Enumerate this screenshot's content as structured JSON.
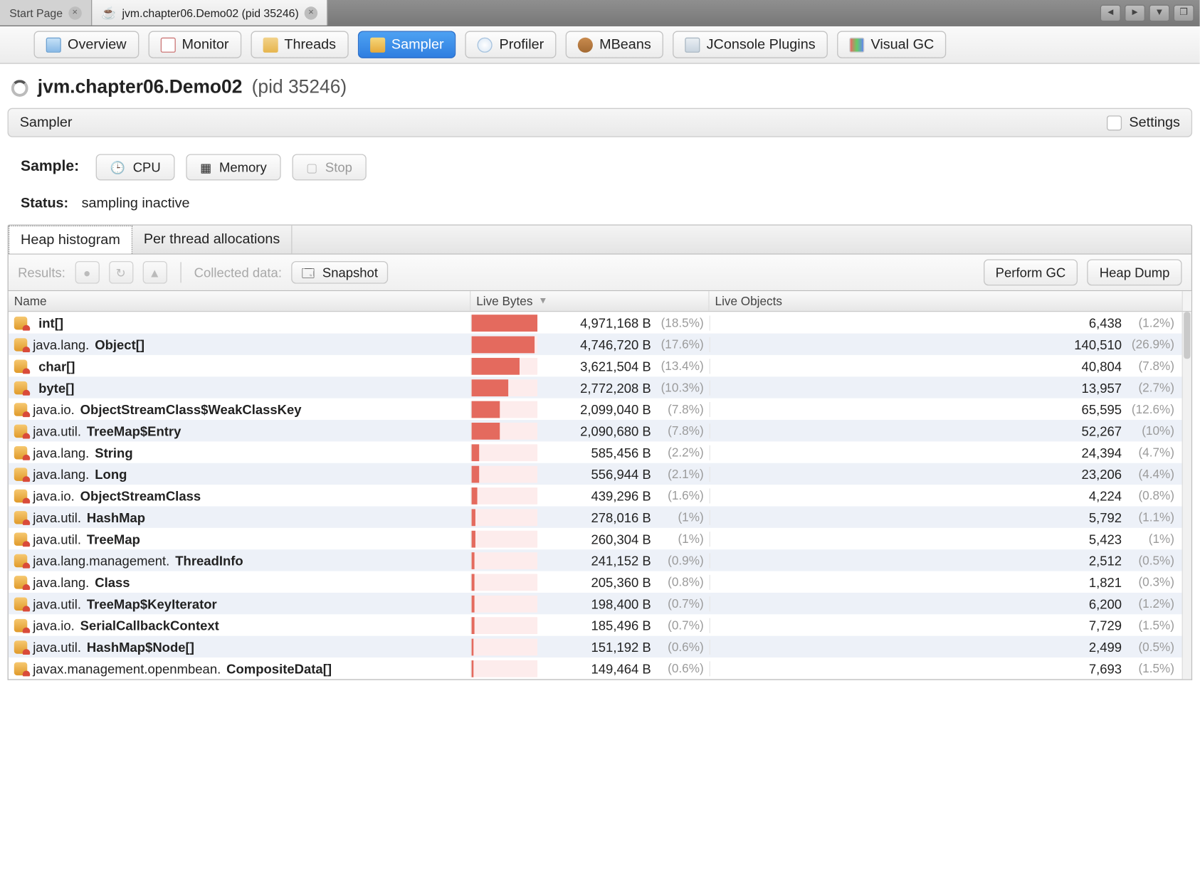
{
  "appTabs": {
    "startPage": "Start Page",
    "activeTab": "jvm.chapter06.Demo02 (pid 35246)"
  },
  "toolbar": {
    "overview": "Overview",
    "monitor": "Monitor",
    "threads": "Threads",
    "sampler": "Sampler",
    "profiler": "Profiler",
    "mbeans": "MBeans",
    "jconsole": "JConsole Plugins",
    "visualgc": "Visual GC"
  },
  "page": {
    "title_bold": "jvm.chapter06.Demo02",
    "title_pid": "(pid 35246)"
  },
  "section": {
    "name": "Sampler",
    "settings": "Settings"
  },
  "sample": {
    "label": "Sample:",
    "cpu": "CPU",
    "memory": "Memory",
    "stop": "Stop"
  },
  "status": {
    "label": "Status:",
    "value": "sampling inactive"
  },
  "subtabs": {
    "heap": "Heap histogram",
    "perthread": "Per thread allocations"
  },
  "resultsbar": {
    "results": "Results:",
    "collected": "Collected data:",
    "snapshot": "Snapshot",
    "performgc": "Perform GC",
    "heapdump": "Heap Dump"
  },
  "columns": {
    "name": "Name",
    "bytes": "Live Bytes",
    "objects": "Live Objects"
  },
  "rows": [
    {
      "prefix": "",
      "bold": "int[]",
      "bytes": "4,971,168 B",
      "bpct": "(18.5%)",
      "bar": 18.5,
      "objs": "6,438",
      "opct": "(1.2%)"
    },
    {
      "prefix": "java.lang.",
      "bold": "Object[]",
      "bytes": "4,746,720 B",
      "bpct": "(17.6%)",
      "bar": 17.6,
      "objs": "140,510",
      "opct": "(26.9%)"
    },
    {
      "prefix": "",
      "bold": "char[]",
      "bytes": "3,621,504 B",
      "bpct": "(13.4%)",
      "bar": 13.4,
      "objs": "40,804",
      "opct": "(7.8%)"
    },
    {
      "prefix": "",
      "bold": "byte[]",
      "bytes": "2,772,208 B",
      "bpct": "(10.3%)",
      "bar": 10.3,
      "objs": "13,957",
      "opct": "(2.7%)"
    },
    {
      "prefix": "java.io.",
      "bold": "ObjectStreamClass$WeakClassKey",
      "bytes": "2,099,040 B",
      "bpct": "(7.8%)",
      "bar": 7.8,
      "objs": "65,595",
      "opct": "(12.6%)"
    },
    {
      "prefix": "java.util.",
      "bold": "TreeMap$Entry",
      "bytes": "2,090,680 B",
      "bpct": "(7.8%)",
      "bar": 7.8,
      "objs": "52,267",
      "opct": "(10%)"
    },
    {
      "prefix": "java.lang.",
      "bold": "String",
      "bytes": "585,456 B",
      "bpct": "(2.2%)",
      "bar": 2.2,
      "objs": "24,394",
      "opct": "(4.7%)"
    },
    {
      "prefix": "java.lang.",
      "bold": "Long",
      "bytes": "556,944 B",
      "bpct": "(2.1%)",
      "bar": 2.1,
      "objs": "23,206",
      "opct": "(4.4%)"
    },
    {
      "prefix": "java.io.",
      "bold": "ObjectStreamClass",
      "bytes": "439,296 B",
      "bpct": "(1.6%)",
      "bar": 1.6,
      "objs": "4,224",
      "opct": "(0.8%)"
    },
    {
      "prefix": "java.util.",
      "bold": "HashMap",
      "bytes": "278,016 B",
      "bpct": "(1%)",
      "bar": 1.0,
      "objs": "5,792",
      "opct": "(1.1%)"
    },
    {
      "prefix": "java.util.",
      "bold": "TreeMap",
      "bytes": "260,304 B",
      "bpct": "(1%)",
      "bar": 1.0,
      "objs": "5,423",
      "opct": "(1%)"
    },
    {
      "prefix": "java.lang.management.",
      "bold": "ThreadInfo",
      "bytes": "241,152 B",
      "bpct": "(0.9%)",
      "bar": 0.9,
      "objs": "2,512",
      "opct": "(0.5%)"
    },
    {
      "prefix": "java.lang.",
      "bold": "Class",
      "bytes": "205,360 B",
      "bpct": "(0.8%)",
      "bar": 0.8,
      "objs": "1,821",
      "opct": "(0.3%)"
    },
    {
      "prefix": "java.util.",
      "bold": "TreeMap$KeyIterator",
      "bytes": "198,400 B",
      "bpct": "(0.7%)",
      "bar": 0.7,
      "objs": "6,200",
      "opct": "(1.2%)"
    },
    {
      "prefix": "java.io.",
      "bold": "SerialCallbackContext",
      "bytes": "185,496 B",
      "bpct": "(0.7%)",
      "bar": 0.7,
      "objs": "7,729",
      "opct": "(1.5%)"
    },
    {
      "prefix": "java.util.",
      "bold": "HashMap$Node[]",
      "bytes": "151,192 B",
      "bpct": "(0.6%)",
      "bar": 0.6,
      "objs": "2,499",
      "opct": "(0.5%)"
    },
    {
      "prefix": "javax.management.openmbean.",
      "bold": "CompositeData[]",
      "bytes": "149,464 B",
      "bpct": "(0.6%)",
      "bar": 0.6,
      "objs": "7,693",
      "opct": "(1.5%)"
    }
  ]
}
